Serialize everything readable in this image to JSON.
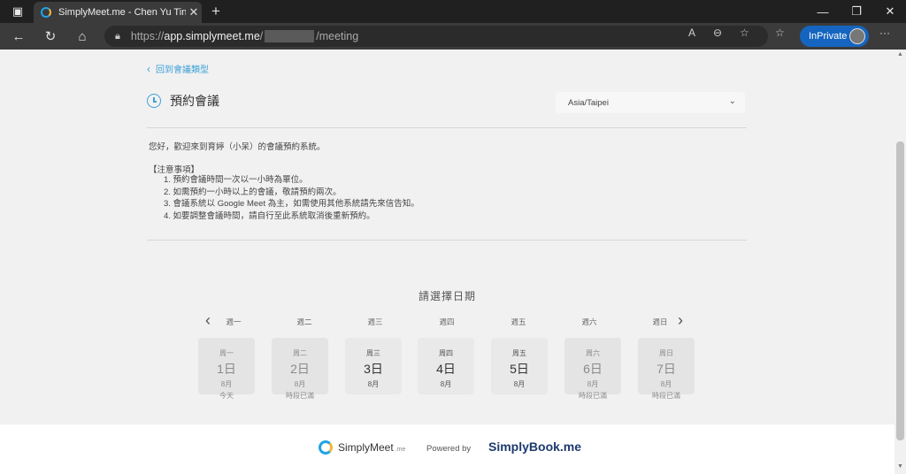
{
  "browser": {
    "tab_title": "SimplyMeet.me - Chen Yu Ting",
    "url_scheme": "https://",
    "url_host": "app.simplymeet.me",
    "url_sep": "/",
    "url_path": "/meeting",
    "inprivate_label": "InPrivate"
  },
  "page": {
    "back_link": "回到會議類型",
    "title": "預約會議",
    "timezone": "Asia/Taipei",
    "intro": "您好，歡迎來到育婷（小呆）的會議預約系統。",
    "notes_title": "【注意事項】",
    "notes": [
      "1. 預約會議時間一次以一小時為單位。",
      "2. 如需預約一小時以上的會議，敬請預約兩次。",
      "3. 會議系統以 Google Meet 為主，如需使用其他系統請先來信告知。",
      "4. 如要調整會議時間，請自行至此系統取消後重新預約。"
    ],
    "pick_date_title": "請選擇日期"
  },
  "calendar": {
    "weekday_headers": [
      "週一",
      "週二",
      "週三",
      "週四",
      "週五",
      "週六",
      "週日"
    ],
    "days": [
      {
        "weekday": "周一",
        "day": "1日",
        "month": "8月",
        "status": "今天",
        "available": false
      },
      {
        "weekday": "周二",
        "day": "2日",
        "month": "8月",
        "status": "時段已滿",
        "available": false
      },
      {
        "weekday": "周三",
        "day": "3日",
        "month": "8月",
        "status": "",
        "available": true
      },
      {
        "weekday": "周四",
        "day": "4日",
        "month": "8月",
        "status": "",
        "available": true
      },
      {
        "weekday": "周五",
        "day": "5日",
        "month": "8月",
        "status": "",
        "available": true
      },
      {
        "weekday": "周六",
        "day": "6日",
        "month": "8月",
        "status": "時段已滿",
        "available": false
      },
      {
        "weekday": "周日",
        "day": "7日",
        "month": "8月",
        "status": "時段已滿",
        "available": false
      }
    ]
  },
  "footer": {
    "simplymeet": "SimplyMeet",
    "simplymeet_suffix": ".me",
    "powered_by": "Powered by",
    "simplybook": "SimplyBook.me"
  },
  "colors": {
    "accent": "#3da1d8",
    "inprivate": "#1565c0",
    "brand_dark": "#1d3a6e"
  }
}
